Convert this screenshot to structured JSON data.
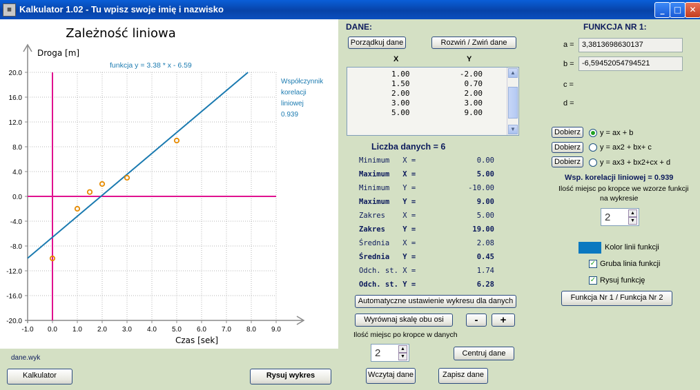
{
  "window": {
    "title": "Kalkulator 1.02 - Tu wpisz swoje imię i nazwisko",
    "minimize": "_",
    "maximize": "□",
    "close": "✕"
  },
  "chart_data": {
    "type": "scatter",
    "title": "Zależność liniowa",
    "ylabel": "Droga [m]",
    "xlabel": "Czas [sek]",
    "xlim": [
      -1.0,
      9.0
    ],
    "ylim": [
      -20.0,
      20.0
    ],
    "x_ticks": [
      "-1.0",
      "0.0",
      "1.0",
      "2.0",
      "3.0",
      "4.0",
      "5.0",
      "6.0",
      "7.0",
      "8.0",
      "9.0"
    ],
    "y_ticks": [
      "20.0",
      "16.0",
      "12.0",
      "8.0",
      "4.0",
      "0.0",
      "-4.0",
      "-8.0",
      "-12.0",
      "-16.0",
      "-20.0"
    ],
    "points": [
      {
        "x": 0.0,
        "y": -10.0
      },
      {
        "x": 1.0,
        "y": -2.0
      },
      {
        "x": 1.5,
        "y": 0.7
      },
      {
        "x": 2.0,
        "y": 2.0
      },
      {
        "x": 3.0,
        "y": 3.0
      },
      {
        "x": 5.0,
        "y": 9.0
      }
    ],
    "fit_line": {
      "slope": 3.38,
      "intercept": -6.59
    },
    "function_label": "funkcja  y =  3.38 * x - 6.59",
    "correlation_label": [
      "Współczynnik",
      "korelacji",
      "liniowej",
      "0.939"
    ],
    "colors": {
      "line": "#1a7ab0",
      "points": "#e58a00",
      "axes": "#e0118f",
      "grid": "#b4b4b4"
    }
  },
  "file_label": "dane.wyk",
  "buttons": {
    "calculator": "Kalkulator",
    "draw_chart": "Rysuj wykres",
    "sort_data": "Porządkuj dane",
    "expand_collapse": "Rozwiń / Zwiń  dane",
    "auto_fit": "Automatyczne ustawienie wykresu dla danych",
    "equalize_scale": "Wyrównaj skalę obu osi",
    "minus": "-",
    "plus": "+",
    "center_data": "Centruj dane",
    "load_data": "Wczytaj dane",
    "save_data": "Zapisz dane",
    "switch_function": "Funkcja Nr 1  /  Funkcja Nr 2",
    "fit_1": "Dobierz",
    "fit_2": "Dobierz",
    "fit_3": "Dobierz"
  },
  "data_panel": {
    "header": "DANE:",
    "col_x": "X",
    "col_y": "Y",
    "rows": [
      {
        "x": "1.00",
        "y": "-2.00"
      },
      {
        "x": "1.50",
        "y": "0.70"
      },
      {
        "x": "2.00",
        "y": "2.00"
      },
      {
        "x": "3.00",
        "y": "3.00"
      },
      {
        "x": "5.00",
        "y": "9.00"
      }
    ],
    "count": "Liczba danych = 6",
    "decimals_label": "Ilość miejsc po kropce w danych",
    "decimals_value": "2"
  },
  "stats": [
    {
      "label": "Minimum   X =",
      "value": "0.00",
      "bold": false
    },
    {
      "label": "Maximum   X =",
      "value": "5.00",
      "bold": true
    },
    {
      "label": "Minimum   Y =",
      "value": "-10.00",
      "bold": false
    },
    {
      "label": "Maximum   Y =",
      "value": "9.00",
      "bold": true
    },
    {
      "label": "Zakres    X =",
      "value": "5.00",
      "bold": false
    },
    {
      "label": "Zakres    Y =",
      "value": "19.00",
      "bold": true
    },
    {
      "label": "Średnia   X =",
      "value": "2.08",
      "bold": false
    },
    {
      "label": "Średnia   Y =",
      "value": "0.45",
      "bold": true
    },
    {
      "label": "Odch. st. X =",
      "value": "1.74",
      "bold": false
    },
    {
      "label": "Odch. st. Y =",
      "value": "6.28",
      "bold": true
    }
  ],
  "function_panel": {
    "header": "FUNKCJA NR 1:",
    "a_label": "a =",
    "a_value": "3,3813698630137",
    "b_label": "b =",
    "b_value": "-6,59452054794521",
    "c_label": "c =",
    "d_label": "d =",
    "opt1": "y = ax + b",
    "opt2": "y = ax2 + bx+ c",
    "opt3": "y = ax3 + bx2+cx + d",
    "correlation": "Wsp. korelacji liniowej = 0.939",
    "decimals_label_1": "Ilość miejsc po kropce we wzorze funkcji",
    "decimals_label_2": "na wykresie",
    "decimals_value": "2",
    "line_color_label": "Kolor linii funkcji",
    "line_color": "#0a78c0",
    "thick_line_label": "Gruba linia funkcji",
    "thick_line_checked": true,
    "draw_function_label": "Rysuj funkcję",
    "draw_function_checked": true
  }
}
